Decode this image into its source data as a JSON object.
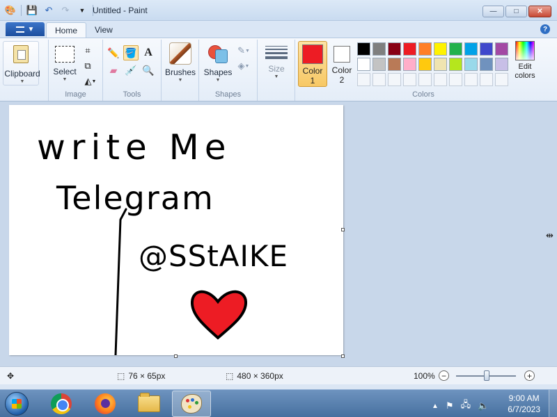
{
  "window": {
    "title": "Untitled - Paint",
    "controls": {
      "minimize": "—",
      "maximize": "□",
      "close": "✕"
    }
  },
  "ribbon": {
    "tabs": [
      {
        "label": "Home",
        "active": true
      },
      {
        "label": "View",
        "active": false
      }
    ],
    "groups": {
      "clipboard": {
        "button": "Clipboard"
      },
      "image": {
        "label": "Image",
        "select_button": "Select"
      },
      "tools": {
        "label": "Tools",
        "selected_tool": "fill"
      },
      "brushes": {
        "button": "Brushes"
      },
      "shapes": {
        "label": "Shapes",
        "button": "Shapes"
      },
      "size": {
        "button": "Size"
      },
      "colors": {
        "label": "Colors",
        "color1_label": "Color\n1",
        "color1_value": "#ed1c24",
        "color2_label": "Color\n2",
        "color2_value": "#ffffff",
        "edit_colors": "Edit\ncolors",
        "palette_row1": [
          "#000000",
          "#7f7f7f",
          "#880015",
          "#ed1c24",
          "#ff7f27",
          "#fff200",
          "#22b14c",
          "#00a2e8",
          "#3f48cc",
          "#a349a4"
        ],
        "palette_row2": [
          "#ffffff",
          "#c3c3c3",
          "#b97a57",
          "#ffaec9",
          "#ffc90e",
          "#efe4b0",
          "#b5e61d",
          "#99d9ea",
          "#7092be",
          "#c8bfe7"
        ]
      }
    }
  },
  "canvas": {
    "drawing_text": [
      "write Me",
      "Telegram",
      "@SStAIKE"
    ],
    "heart_color": "#ed1c24"
  },
  "status": {
    "selection_size": "76 × 65px",
    "canvas_size": "480 × 360px",
    "zoom": "100%"
  },
  "taskbar": {
    "apps": [
      "Start",
      "Google Chrome",
      "Firefox",
      "Windows Explorer",
      "Paint"
    ],
    "time": "9:00 AM",
    "date": "6/7/2023"
  }
}
